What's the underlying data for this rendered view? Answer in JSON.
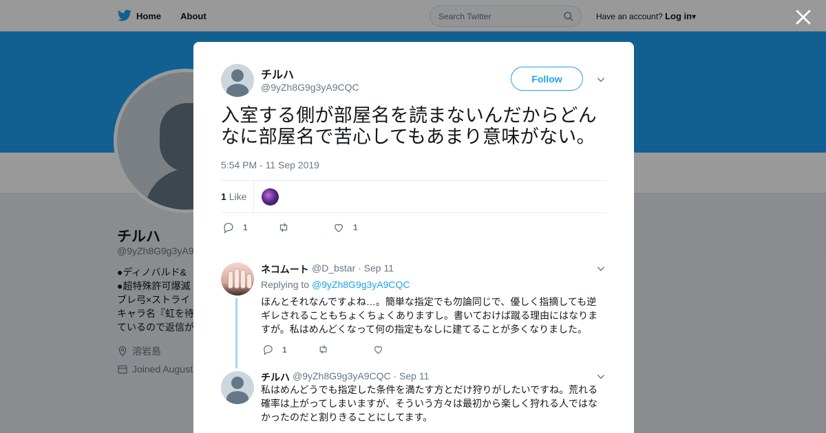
{
  "topnav": {
    "home_label": "Home",
    "about_label": "About",
    "search_placeholder": "Search Twitter",
    "account_prompt": "Have an account?",
    "login_label": "Log in"
  },
  "profile": {
    "name": "チルハ",
    "handle": "@9yZh8G9g3yA9",
    "bio_lines": [
      "●ディノバルド&",
      "●超特殊許可爆滅",
      "ブレ弓×ストライ",
      "キャラ名『虹を待",
      "ているので返信が"
    ],
    "location": "溶岩島",
    "joined": "Joined August"
  },
  "tweet": {
    "author_name": "チルハ",
    "author_handle": "@9yZh8G9g3yA9CQC",
    "follow_label": "Follow",
    "text": "入室する側が部屋名を読まないんだからどんなに部屋名で苦心してもあまり意味がない。",
    "timestamp": "5:54 PM - 11 Sep 2019",
    "likes_count": "1",
    "likes_label": "Like",
    "reply_count": "1",
    "retweet_count": "",
    "like_count": "1"
  },
  "replies": [
    {
      "name": "ネコムート",
      "handle": "@D_bstar",
      "date": "· Sep 11",
      "replying_to_label": "Replying to",
      "replying_to_handle": "@9yZh8G9g3yA9CQC",
      "text": "ほんとそれなんですよね…。簡単な指定でも勿論同じで、優しく指摘しても逆ギレされることもちょくちょくありますし。書いておけば蹴る理由にはなりますが。私はめんどくなって何の指定もなしに建てることが多くなりました。",
      "reply_count": "1"
    },
    {
      "name": "チルハ",
      "handle": "@9yZh8G9g3yA9CQC",
      "date": "· Sep 11",
      "text": "私はめんどうでも指定した条件を満たす方とだけ狩りがしたいですね。荒れる確率は上がってしまいますが、そういう方々は最初から楽しく狩れる人ではなかったのだと割りきることにしてます。"
    }
  ],
  "colors": {
    "accent": "#1da1f2",
    "banner": "#1da1f2",
    "muted": "#657786",
    "thread_line": "#a3d4f7"
  }
}
